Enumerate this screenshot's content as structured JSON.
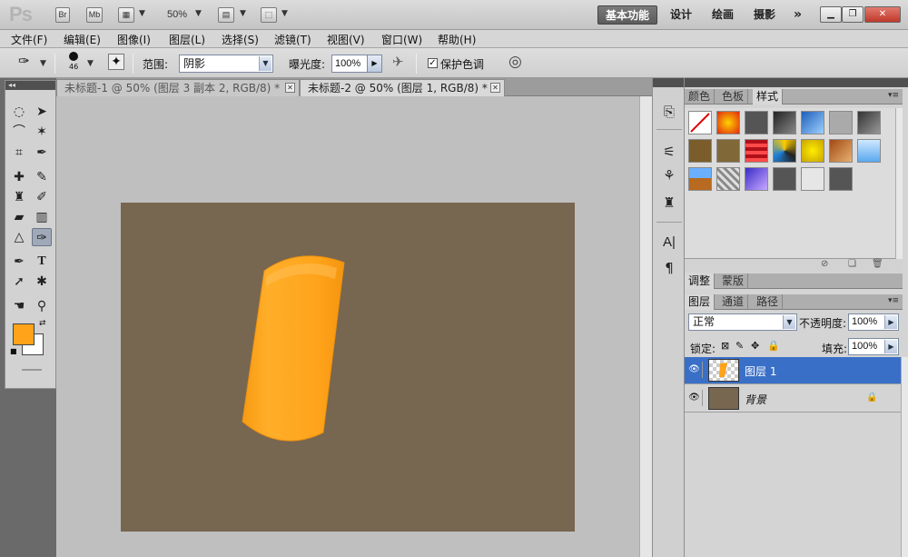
{
  "app": {
    "logo": "Ps",
    "bridge_label": "Br",
    "minibridge_label": "Mb",
    "zoom": "50%",
    "workspaces": [
      "基本功能",
      "设计",
      "绘画",
      "摄影"
    ],
    "more": "»"
  },
  "menu": [
    "文件(F)",
    "编辑(E)",
    "图像(I)",
    "图层(L)",
    "选择(S)",
    "滤镜(T)",
    "视图(V)",
    "窗口(W)",
    "帮助(H)"
  ],
  "options": {
    "brush_size": "46",
    "range_label": "范围:",
    "range_value": "阴影",
    "exposure_label": "曝光度:",
    "exposure_value": "100%",
    "protect_tones_label": "保护色调",
    "protect_tones_checked": true
  },
  "colors": {
    "foreground": "#ffa31a",
    "background": "#ffffff",
    "canvas": "#776650",
    "shape": "#ffa31a",
    "selected_layer": "#3a6fc7"
  },
  "documents": [
    {
      "title": "未标题-1 @ 50% (图层 3 副本 2, RGB/8) *",
      "active": false
    },
    {
      "title": "未标题-2 @ 50% (图层 1, RGB/8) *",
      "active": true
    }
  ],
  "panels": {
    "top_tabs": [
      "颜色",
      "色板",
      "样式"
    ],
    "mid_tabs": [
      "调整",
      "蒙版"
    ],
    "layer_tabs": [
      "图层",
      "通道",
      "路径"
    ],
    "blend_mode": "正常",
    "opacity_label": "不透明度:",
    "opacity_value": "100%",
    "lock_label": "锁定:",
    "fill_label": "填充:",
    "fill_value": "100%",
    "layers": [
      {
        "name": "图层 1",
        "selected": true
      },
      {
        "name": "背景",
        "selected": false,
        "locked": true
      }
    ]
  }
}
